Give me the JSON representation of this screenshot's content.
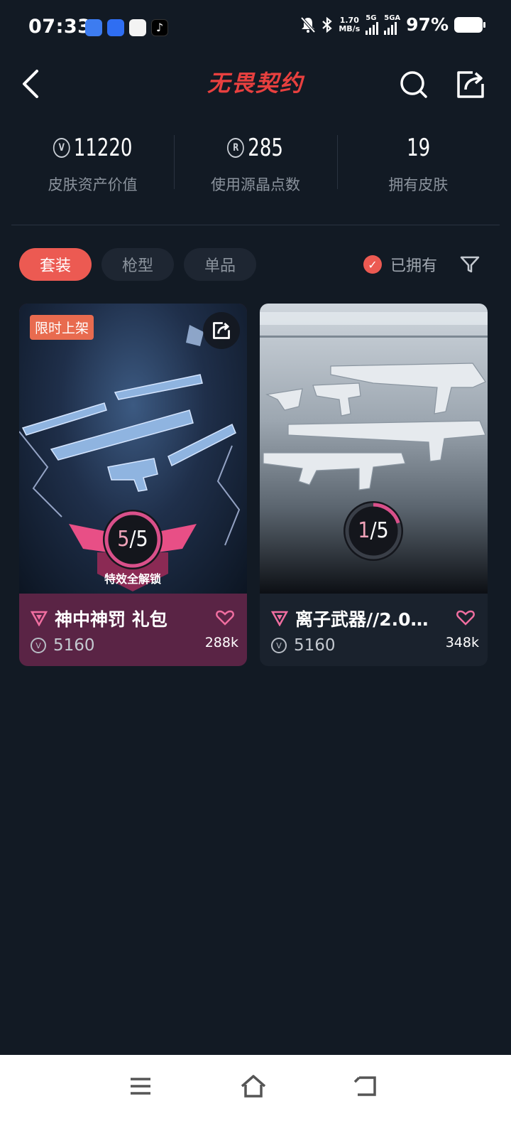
{
  "status_bar": {
    "time": "07:33",
    "net_speed": "1.70",
    "net_unit": "MB/s",
    "sim1": "5G",
    "sim2": "5GA",
    "battery": "97%"
  },
  "header": {
    "logo_text": "无畏契约"
  },
  "stats": [
    {
      "value": "11220",
      "label": "皮肤资产价值",
      "icon": "v-coin-icon"
    },
    {
      "value": "285",
      "label": "使用源晶点数",
      "icon": "radianite-icon"
    },
    {
      "value": "19",
      "label": "拥有皮肤"
    }
  ],
  "filters": {
    "tabs": [
      "套装",
      "枪型",
      "单品"
    ],
    "owned_label": "已拥有"
  },
  "cards": [
    {
      "tag": "限时上架",
      "progress_current": "5",
      "progress_total": "/5",
      "progress_fraction": 1.0,
      "unlock_text": "特效全解锁",
      "title": "神中神罚 礼包",
      "price": "5160",
      "likes": "288k"
    },
    {
      "progress_current": "1",
      "progress_total": "/5",
      "progress_fraction": 0.2,
      "title": "离子武器//2.0…",
      "price": "5160",
      "likes": "348k"
    }
  ],
  "colors": {
    "accent": "#ec5a52",
    "logo": "#e8403f",
    "background": "#121a24"
  }
}
